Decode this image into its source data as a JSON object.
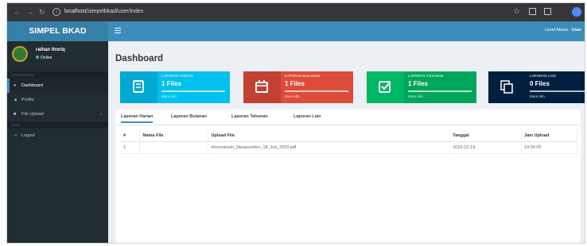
{
  "browser": {
    "url_host": "localhost",
    "url_path": "/simpelbkad/user/index"
  },
  "app": {
    "logo_text": "SIMPEL BKAD"
  },
  "user": {
    "name": "raihan thoriq",
    "status": "Online"
  },
  "sidebar": {
    "section_navigation": "NAVIGATION",
    "section_other": "LAIN",
    "items": [
      {
        "label": "Dashboard",
        "icon": "tachometer-icon"
      },
      {
        "label": "Profile",
        "icon": "user-icon"
      },
      {
        "label": "File Upload",
        "icon": "file-upload-icon"
      },
      {
        "label": "Logout",
        "icon": "sign-out-icon"
      }
    ]
  },
  "header": {
    "level_prefix": "Level Akses :",
    "level_value": "User"
  },
  "page": {
    "title": "Dashboard"
  },
  "stat_boxes": [
    {
      "title": "LAPORAN HARIAN",
      "count": "1 Files",
      "more": "More info",
      "color": "#00c0ef",
      "icon": "book-icon"
    },
    {
      "title": "LAPORAN BULANAN",
      "count": "1 Files",
      "more": "More info",
      "color": "#dd4b39",
      "icon": "calendar-icon"
    },
    {
      "title": "LAPORAN TAHUNAN",
      "count": "1 Files",
      "more": "More info",
      "color": "#00a65a",
      "icon": "check-square-icon"
    },
    {
      "title": "LAPORAN LAIN",
      "count": "0 Files",
      "more": "More info",
      "color": "#001f3f",
      "icon": "copy-icon"
    }
  ],
  "tabs": [
    {
      "label": "Laporan Harian",
      "active": true
    },
    {
      "label": "Laporan Bulanan",
      "active": false
    },
    {
      "label": "Laporan Tahunan",
      "active": false
    },
    {
      "label": "Laporan Lain",
      "active": false
    }
  ],
  "table": {
    "headers": [
      "#",
      "Nama File",
      "Upload File",
      "Tanggal",
      "Jam Upload"
    ],
    "rows": [
      [
        "1",
        "",
        "Honorarium_Narasumber_18_Juli_2023.pdf",
        "2023-12-19",
        "19:35:05"
      ]
    ]
  }
}
